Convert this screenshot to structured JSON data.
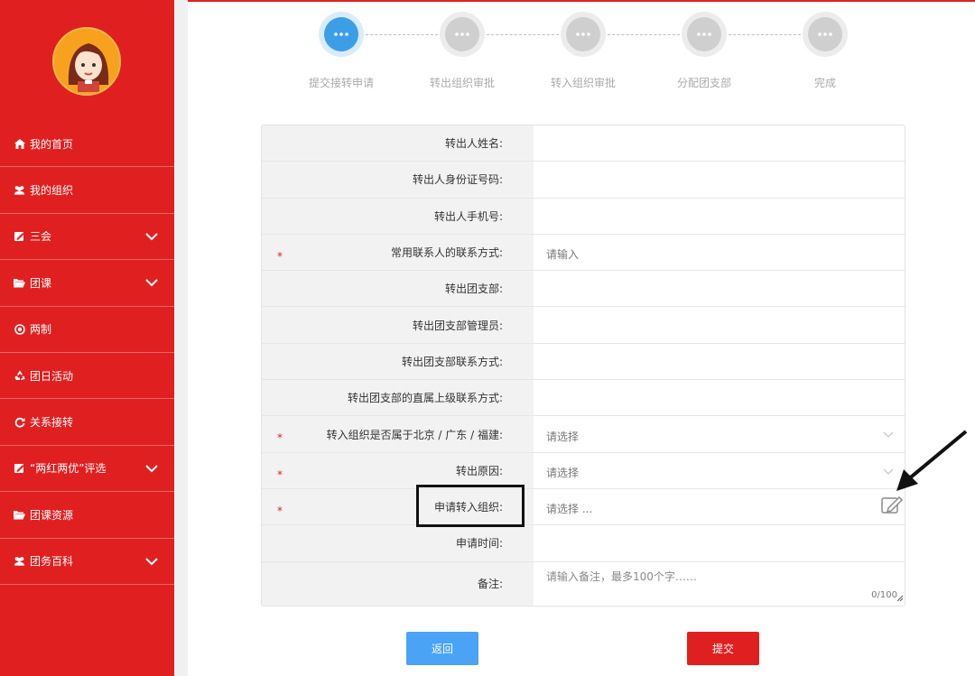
{
  "sidebar": {
    "items": [
      {
        "label": "我的首页",
        "icon": "home-icon",
        "expand": false
      },
      {
        "label": "我的组织",
        "icon": "users-icon",
        "expand": false
      },
      {
        "label": "三会",
        "icon": "edit-icon",
        "expand": true
      },
      {
        "label": "团课",
        "icon": "folder-open-icon",
        "expand": true
      },
      {
        "label": "两制",
        "icon": "dot-circle-icon",
        "expand": false
      },
      {
        "label": "团日活动",
        "icon": "recycle-icon",
        "expand": false
      },
      {
        "label": "关系接转",
        "icon": "refresh-icon",
        "expand": false
      },
      {
        "label": "“两红两优”评选",
        "icon": "edit-icon",
        "expand": true
      },
      {
        "label": "团课资源",
        "icon": "folder-open-icon",
        "expand": false
      },
      {
        "label": "团务百科",
        "icon": "users-icon",
        "expand": true
      }
    ]
  },
  "steps": [
    {
      "label": "提交接转申请",
      "active": true
    },
    {
      "label": "转出组织审批",
      "active": false
    },
    {
      "label": "转入组织审批",
      "active": false
    },
    {
      "label": "分配团支部",
      "active": false
    },
    {
      "label": "完成",
      "active": false
    }
  ],
  "form": {
    "rows": [
      {
        "label": "转出人姓名:",
        "required": false,
        "value": "",
        "type": "text"
      },
      {
        "label": "转出人身份证号码:",
        "required": false,
        "value": "",
        "type": "text"
      },
      {
        "label": "转出人手机号:",
        "required": false,
        "value": "",
        "type": "text"
      },
      {
        "label": "常用联系人的联系方式:",
        "required": true,
        "value": "请输入",
        "type": "input"
      },
      {
        "label": "转出团支部:",
        "required": false,
        "value": "",
        "type": "text"
      },
      {
        "label": "转出团支部管理员:",
        "required": false,
        "value": "",
        "type": "text"
      },
      {
        "label": "转出团支部联系方式:",
        "required": false,
        "value": "",
        "type": "text"
      },
      {
        "label": "转出团支部的直属上级联系方式:",
        "required": false,
        "value": "",
        "type": "text"
      },
      {
        "label": "转入组织是否属于北京 / 广东 / 福建:",
        "required": true,
        "value": "请选择",
        "type": "select"
      },
      {
        "label": "转出原因:",
        "required": true,
        "value": "请选择",
        "type": "select"
      },
      {
        "label": "申请转入组织:",
        "required": true,
        "value": "请选择 ...",
        "type": "picker"
      },
      {
        "label": "申请时间:",
        "required": false,
        "value": "",
        "type": "text"
      },
      {
        "label": "备注:",
        "required": false,
        "value": "请输入备注，最多100个字……",
        "type": "textarea",
        "counter": "0/100"
      }
    ],
    "required_mark": "*"
  },
  "buttons": {
    "back": "返回",
    "submit": "提交"
  },
  "colors": {
    "brand_red": "#e02020",
    "active_step": "#3d9ee8",
    "inactive_step": "#cfcfcf",
    "back_blue": "#4aa3f5"
  }
}
